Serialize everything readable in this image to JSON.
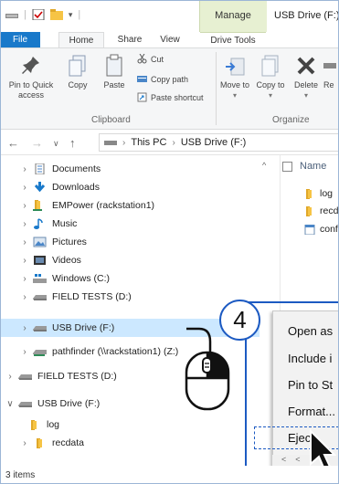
{
  "window": {
    "title": "USB Drive (F:)",
    "contextual_tab_group": "Manage"
  },
  "ribbon_tabs": [
    {
      "label": "File"
    },
    {
      "label": "Home"
    },
    {
      "label": "Share"
    },
    {
      "label": "View"
    },
    {
      "label": "Drive Tools"
    }
  ],
  "ribbon": {
    "pin_to_quick_access": "Pin to Quick access",
    "copy": "Copy",
    "paste": "Paste",
    "cut": "Cut",
    "copy_path": "Copy path",
    "paste_shortcut": "Paste shortcut",
    "clipboard_group": "Clipboard",
    "move_to": "Move to",
    "copy_to": "Copy to",
    "delete": "Delete",
    "rename": "Re",
    "organize_group": "Organize"
  },
  "address": {
    "crumbs": [
      "This PC",
      "USB Drive (F:)"
    ]
  },
  "nav_tree": [
    {
      "label": "Documents",
      "icon": "documents-icon"
    },
    {
      "label": "Downloads",
      "icon": "downloads-icon"
    },
    {
      "label": "EMPower (rackstation1)",
      "icon": "folder-icon"
    },
    {
      "label": "Music",
      "icon": "music-icon"
    },
    {
      "label": "Pictures",
      "icon": "pictures-icon"
    },
    {
      "label": "Videos",
      "icon": "videos-icon"
    },
    {
      "label": "Windows (C:)",
      "icon": "windows-drive-icon"
    },
    {
      "label": "FIELD TESTS (D:)",
      "icon": "drive-icon"
    },
    {
      "label": "USB Drive (F:)",
      "icon": "drive-icon"
    },
    {
      "label": "pathfinder (\\\\rackstation1) (Z:)",
      "icon": "network-drive-icon"
    },
    {
      "label": "FIELD TESTS (D:)",
      "icon": "drive-icon"
    },
    {
      "label": "USB Drive (F:)",
      "icon": "drive-icon"
    },
    {
      "label": "log",
      "icon": "folder-icon"
    },
    {
      "label": "recdata",
      "icon": "folder-icon"
    }
  ],
  "content": {
    "name_header": "Name",
    "files": [
      {
        "label": "log",
        "icon": "folder-icon"
      },
      {
        "label": "recd",
        "icon": "folder-icon"
      },
      {
        "label": "conf",
        "icon": "config-file-icon"
      }
    ]
  },
  "context_menu": {
    "items": [
      {
        "label": "Open as"
      },
      {
        "label": "Include i"
      },
      {
        "label": "Pin to St"
      },
      {
        "label": "Format..."
      },
      {
        "label": "Eject"
      }
    ]
  },
  "step_number": "4",
  "status": {
    "item_count": "3 items"
  },
  "colors": {
    "accent": "#1979ca",
    "selection": "#cce8ff",
    "manage_band": "#e7f0d2",
    "annotation_blue": "#1c5ac2"
  }
}
